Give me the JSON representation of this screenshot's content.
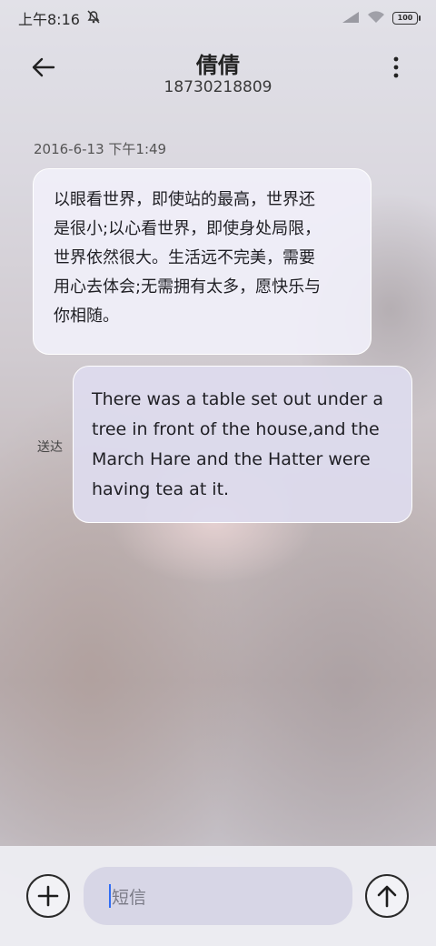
{
  "status_bar": {
    "time": "上午8:16",
    "icons": [
      "silent-icon",
      "signal-icon",
      "wifi-icon"
    ],
    "battery": "100"
  },
  "header": {
    "contact_name": "倩倩",
    "phone_number": "18730218809",
    "back_icon": "back-arrow-icon",
    "more_icon": "more-vertical-icon"
  },
  "conversation": {
    "timestamp": "2016-6-13 下午1:49",
    "messages": [
      {
        "direction": "incoming",
        "lines": [
          "以眼看世界，即使站的最高，世界还",
          "是很小;以心看世界，即使身处局限，",
          "世界依然很大。生活远不完美，需要",
          "用心去体会;无需拥有太多，愿快乐与",
          "你相随。"
        ]
      },
      {
        "direction": "outgoing",
        "lines": [
          "There was a table set out under a",
          "tree in front of the house,and the",
          "March Hare and the Hatter were",
          "having tea at it."
        ],
        "status": "送达"
      }
    ]
  },
  "input_bar": {
    "placeholder": "短信",
    "add_icon": "plus-icon",
    "send_icon": "send-arrow-icon"
  },
  "colors": {
    "incoming_bubble": "#f0eff9",
    "outgoing_bubble": "#dedcee",
    "input_field": "#d7d6e6",
    "caret": "#2f6df5"
  }
}
